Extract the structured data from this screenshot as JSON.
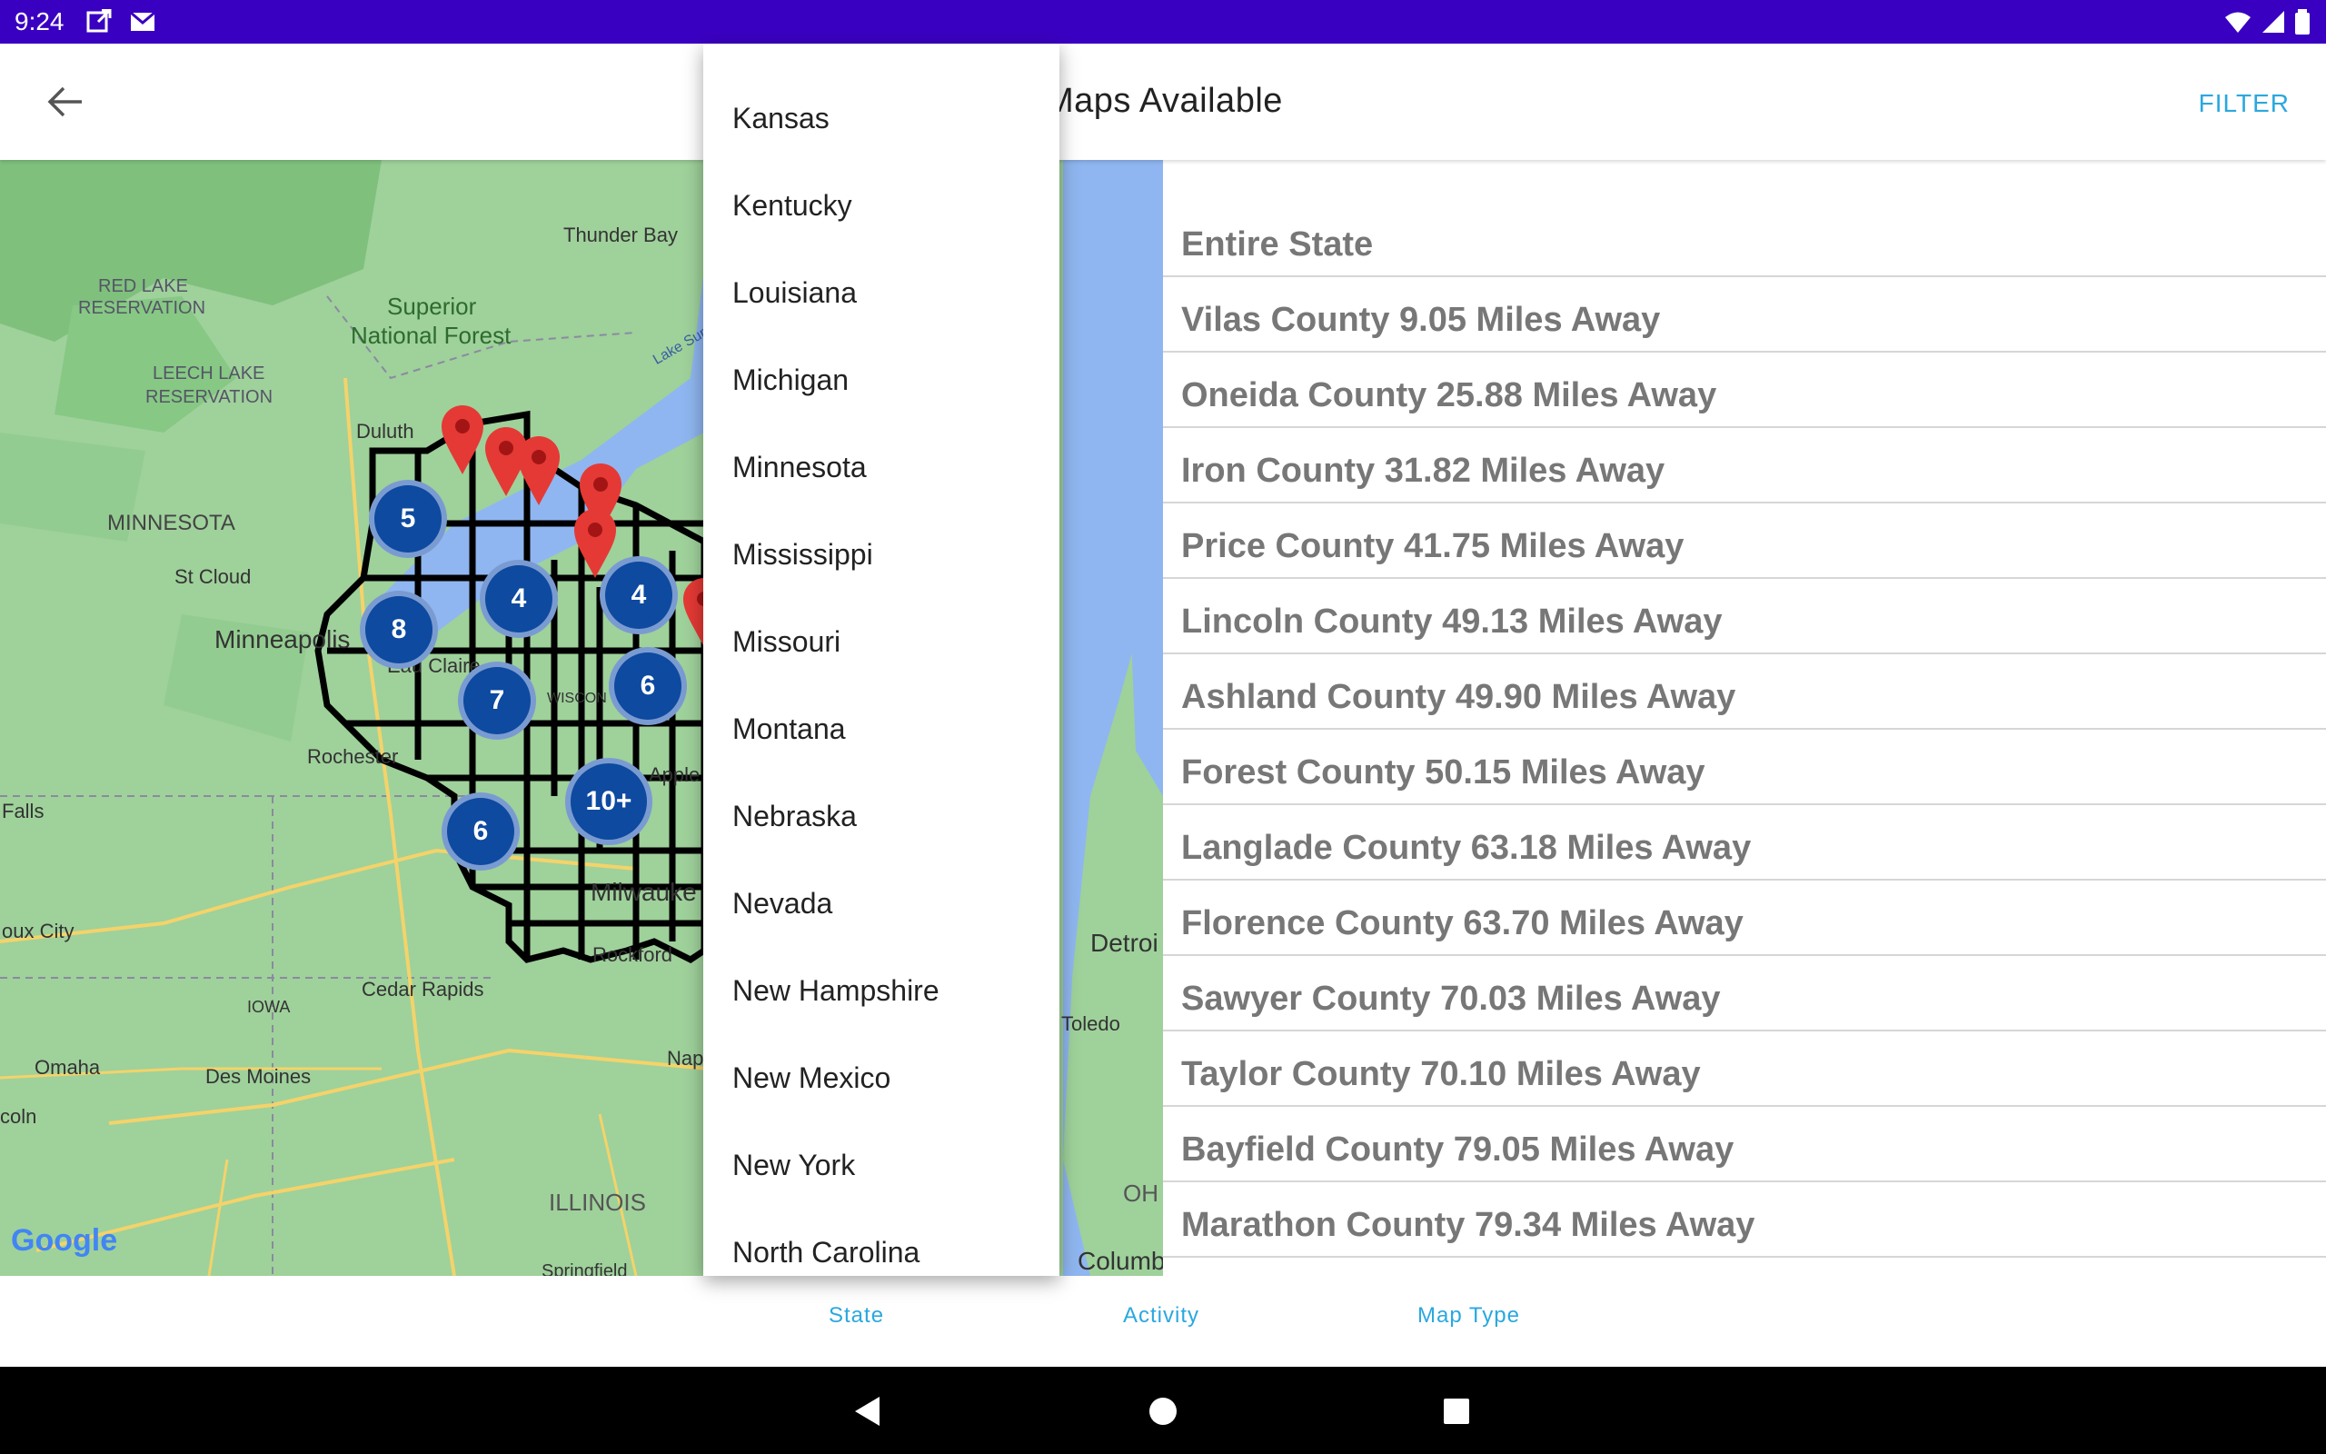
{
  "status_bar": {
    "time": "9:24"
  },
  "app_bar": {
    "title": "Maps Available",
    "title_visible": "laps Available",
    "filter_label": "FILTER"
  },
  "map": {
    "google_logo": "Google",
    "labels": [
      {
        "text": "Thunder Bay"
      },
      {
        "text": "RED LAKE"
      },
      {
        "text": "RESERVATION"
      },
      {
        "text": "Superior"
      },
      {
        "text": "National Forest"
      },
      {
        "text": "LEECH LAKE"
      },
      {
        "text": "RESERVATION"
      },
      {
        "text": "Duluth"
      },
      {
        "text": "MINNESOTA"
      },
      {
        "text": "St Cloud"
      },
      {
        "text": "Minneapolis"
      },
      {
        "text": "Eau Claire"
      },
      {
        "text": "WISCON"
      },
      {
        "text": "Rochester"
      },
      {
        "text": "Falls"
      },
      {
        "text": "Apple"
      },
      {
        "text": "Milwauke"
      },
      {
        "text": "Rockford"
      },
      {
        "text": "oux City"
      },
      {
        "text": "Cedar Rapids"
      },
      {
        "text": "IOWA"
      },
      {
        "text": "Omaha"
      },
      {
        "text": "Des Moines"
      },
      {
        "text": "coln"
      },
      {
        "text": "ILLINOIS"
      },
      {
        "text": "Springfield"
      },
      {
        "text": "Nap"
      },
      {
        "text": "Detroi"
      },
      {
        "text": "Toledo"
      },
      {
        "text": "OH"
      },
      {
        "text": "Columb"
      },
      {
        "text": "Lake Sup"
      }
    ],
    "clusters": [
      "5",
      "8",
      "4",
      "4",
      "7",
      "6",
      "10+",
      "6"
    ]
  },
  "state_dropdown": {
    "items": [
      "Kansas",
      "Kentucky",
      "Louisiana",
      "Michigan",
      "Minnesota",
      "Mississippi",
      "Missouri",
      "Montana",
      "Nebraska",
      "Nevada",
      "New Hampshire",
      "New Mexico",
      "New York",
      "North Carolina"
    ]
  },
  "county_list": {
    "items": [
      "Entire State",
      "Vilas County 9.05 Miles Away",
      "Oneida County 25.88 Miles Away",
      "Iron County 31.82 Miles Away",
      "Price County 41.75 Miles Away",
      "Lincoln County 49.13 Miles Away",
      "Ashland County 49.90 Miles Away",
      "Forest County 50.15 Miles Away",
      "Langlade County 63.18 Miles Away",
      "Florence County 63.70 Miles Away",
      "Sawyer County 70.03 Miles Away",
      "Taylor County 70.10 Miles Away",
      "Bayfield County 79.05 Miles Away",
      "Marathon County 79.34 Miles Away"
    ]
  },
  "tabs": {
    "state": "State",
    "activity": "Activity",
    "map_type": "Map Type"
  },
  "colors": {
    "status_bar": "#3a00c2",
    "accent": "#2aa8df",
    "cluster": "#0d4aa0",
    "pin": "#e53935",
    "map_land": "#9fd19b",
    "water": "#8fb6f0"
  }
}
